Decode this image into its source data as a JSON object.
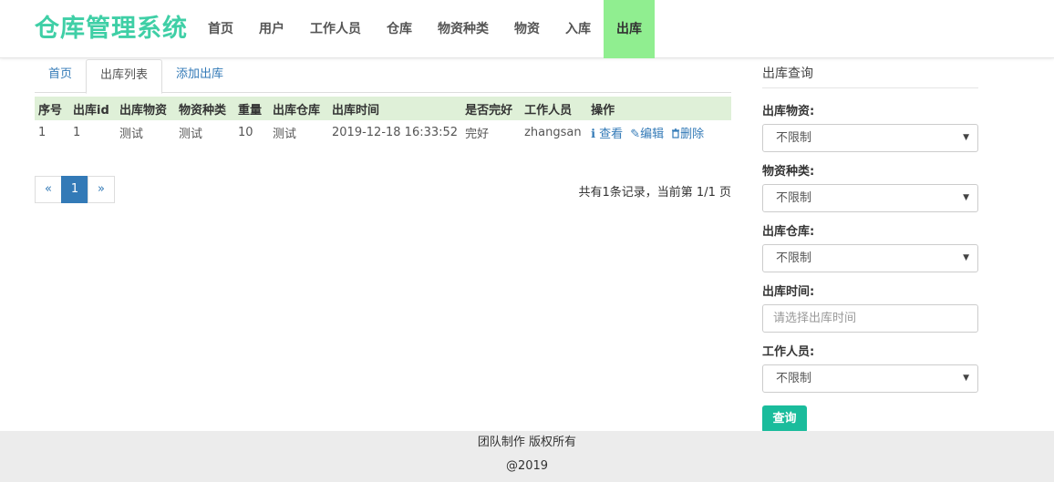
{
  "brand": "仓库管理系统",
  "nav": [
    "首页",
    "用户",
    "工作人员",
    "仓库",
    "物资种类",
    "物资",
    "入库",
    "出库"
  ],
  "tabs": [
    "首页",
    "出库列表",
    "添加出库"
  ],
  "table": {
    "headers": [
      "序号",
      "出库id",
      "出库物资",
      "物资种类",
      "重量",
      "出库仓库",
      "出库时间",
      "是否完好",
      "工作人员",
      "操作"
    ],
    "rows": [
      [
        "1",
        "1",
        "测试",
        "测试",
        "10",
        "测试",
        "2019-12-18 16:33:52",
        "完好",
        "zhangsan"
      ]
    ],
    "ops": {
      "view": "查看",
      "edit": "编辑",
      "delete": "删除"
    }
  },
  "pagination": {
    "prev": "«",
    "current": "1",
    "next": "»"
  },
  "summary": "共有1条记录，当前第 1/1 页",
  "side": {
    "title": "出库查询",
    "goods_label": "出库物资:",
    "goods_value": "不限制",
    "category_label": "物资种类:",
    "category_value": "不限制",
    "warehouse_label": "出库仓库:",
    "warehouse_value": "不限制",
    "time_label": "出库时间:",
    "time_placeholder": "请选择出库时间",
    "staff_label": "工作人员:",
    "staff_value": "不限制",
    "query_button": "查询"
  },
  "footer": {
    "line1": "团队制作 版权所有",
    "line2": "@2019"
  },
  "colors": {
    "brand": "#3fcfa6",
    "nav_active": "#90ee90",
    "table_header": "#dff0d8",
    "link": "#337ab7",
    "query_button": "#1abc9c"
  }
}
